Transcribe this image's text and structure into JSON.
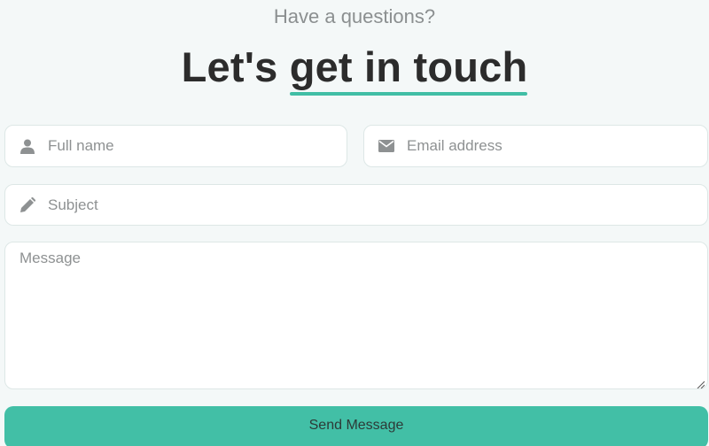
{
  "header": {
    "kicker": "Have a questions?",
    "headline_plain": "Let's ",
    "headline_accent": "get in touch"
  },
  "form": {
    "full_name": {
      "placeholder": "Full name",
      "value": "",
      "icon": "user-icon"
    },
    "email": {
      "placeholder": "Email address",
      "value": "",
      "icon": "envelope-icon"
    },
    "subject": {
      "placeholder": "Subject",
      "value": "",
      "icon": "pencil-icon"
    },
    "message": {
      "placeholder": "Message",
      "value": ""
    },
    "submit_label": "Send Message"
  },
  "colors": {
    "accent": "#41bea5",
    "background": "#f4f8f8",
    "heading": "#2c2c2c",
    "muted": "#8b8f90"
  }
}
